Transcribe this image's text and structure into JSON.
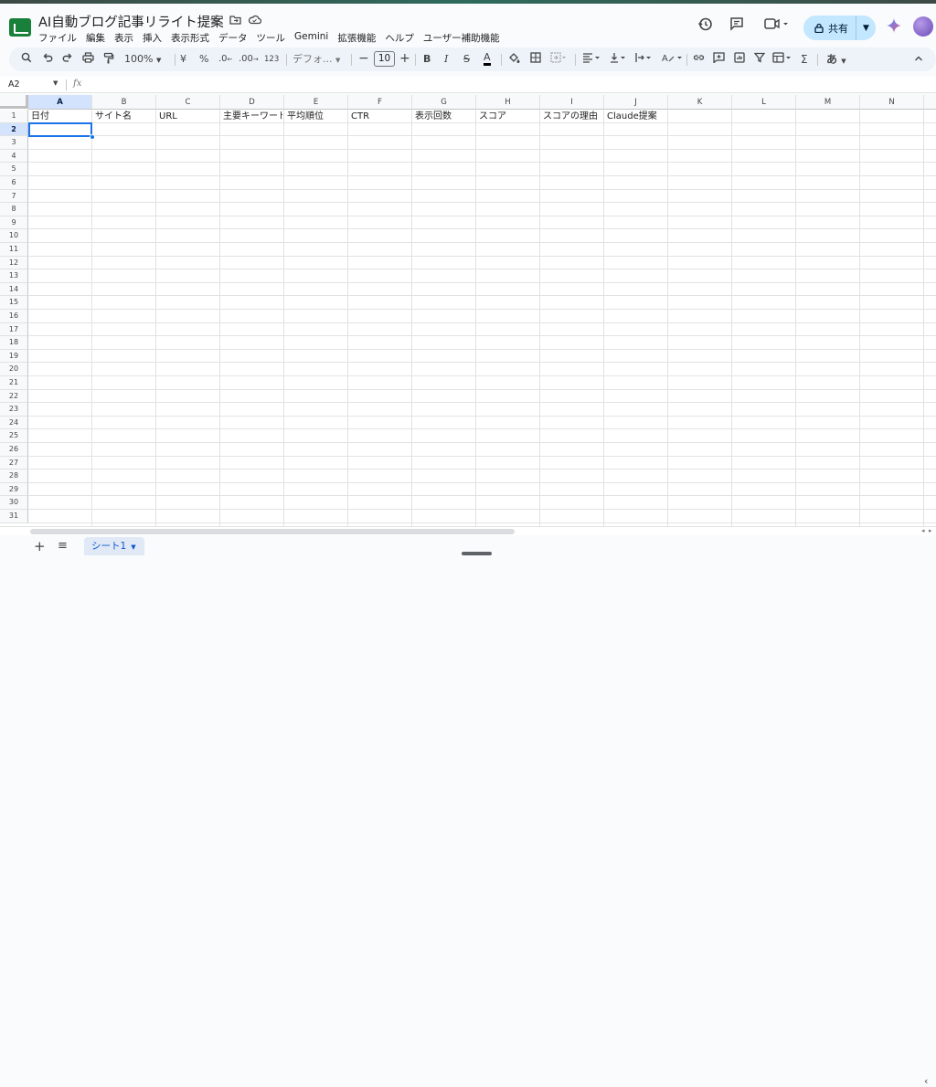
{
  "document": {
    "title": "AI自動ブログ記事リライト提案",
    "star_icon": "star-icon",
    "move_icon": "folder-move-icon",
    "cloud_icon": "cloud-status-icon"
  },
  "menu": [
    "ファイル",
    "編集",
    "表示",
    "挿入",
    "表示形式",
    "データ",
    "ツール",
    "Gemini",
    "拡張機能",
    "ヘルプ",
    "ユーザー補助機能"
  ],
  "header_right": {
    "history_icon": "history-icon",
    "comments_icon": "comment-icon",
    "meet_icon": "video-call-icon",
    "share_label": "共有",
    "gemini_icon": "gemini-sparkle-icon"
  },
  "toolbar": {
    "zoom": "100%",
    "currency": "¥",
    "percent": "%",
    "decrease_decimal": ".0",
    "increase_decimal": ".00",
    "number_format": "123",
    "font": "デフォ...",
    "font_size": "10",
    "bold": "B",
    "italic": "I",
    "strike": "S",
    "text_color": "A",
    "ime": "あ",
    "sum": "Σ"
  },
  "formula_bar": {
    "cell_ref": "A2",
    "fx": "fx",
    "content": ""
  },
  "columns": [
    "A",
    "B",
    "C",
    "D",
    "E",
    "F",
    "G",
    "H",
    "I",
    "J",
    "K",
    "L",
    "M",
    "N"
  ],
  "selected_column": "A",
  "selected_row": 2,
  "rows": [
    "1",
    "2",
    "3",
    "4",
    "5",
    "6",
    "7",
    "8",
    "9",
    "10",
    "11",
    "12",
    "13",
    "14",
    "15",
    "16",
    "17",
    "18",
    "19",
    "20",
    "21",
    "22",
    "23",
    "24",
    "25",
    "26",
    "27",
    "28",
    "29",
    "30",
    "31"
  ],
  "header_row": [
    "日付",
    "サイト名",
    "URL",
    "主要キーワード",
    "平均順位",
    "CTR",
    "表示回数",
    "スコア",
    "スコアの理由",
    "Claude提案"
  ],
  "sheets": {
    "active": "シート1"
  },
  "colors": {
    "accent": "#1a73e8",
    "share_bg": "#c2e7ff",
    "sheets_green": "#188038"
  }
}
